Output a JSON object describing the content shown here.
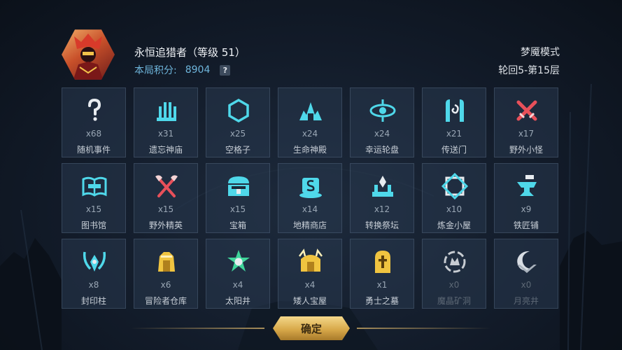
{
  "player": {
    "name": "永恒追猎者（等级 51）",
    "score_label": "本局积分:",
    "score_value": "8904",
    "help_icon": "?"
  },
  "mode": "梦魇模式",
  "floor": "轮回5-第15层",
  "cells": [
    {
      "icon": "question-icon",
      "count": "x68",
      "label": "随机事件",
      "dim": false
    },
    {
      "icon": "temple-icon",
      "count": "x31",
      "label": "遗忘神庙",
      "dim": false
    },
    {
      "icon": "hexagon-icon",
      "count": "x25",
      "label": "空格子",
      "dim": false
    },
    {
      "icon": "life-temple-icon",
      "count": "x24",
      "label": "生命神殿",
      "dim": false
    },
    {
      "icon": "wheel-icon",
      "count": "x24",
      "label": "幸运轮盘",
      "dim": false
    },
    {
      "icon": "portal-icon",
      "count": "x21",
      "label": "传送门",
      "dim": false
    },
    {
      "icon": "crossed-swords-icon",
      "count": "x17",
      "label": "野外小怪",
      "dim": false
    },
    {
      "icon": "book-icon",
      "count": "x15",
      "label": "图书馆",
      "dim": false
    },
    {
      "icon": "crossed-axes-icon",
      "count": "x15",
      "label": "野外精英",
      "dim": false
    },
    {
      "icon": "chest-icon",
      "count": "x15",
      "label": "宝箱",
      "dim": false
    },
    {
      "icon": "shop-icon",
      "count": "x14",
      "label": "地精商店",
      "dim": false
    },
    {
      "icon": "altar-icon",
      "count": "x12",
      "label": "转换祭坛",
      "dim": false
    },
    {
      "icon": "alchemy-icon",
      "count": "x10",
      "label": "炼金小屋",
      "dim": false
    },
    {
      "icon": "anvil-icon",
      "count": "x9",
      "label": "铁匠铺",
      "dim": false
    },
    {
      "icon": "seal-icon",
      "count": "x8",
      "label": "封印柱",
      "dim": false
    },
    {
      "icon": "warehouse-icon",
      "count": "x6",
      "label": "冒险者仓库",
      "dim": false
    },
    {
      "icon": "sun-well-icon",
      "count": "x4",
      "label": "太阳井",
      "dim": false
    },
    {
      "icon": "dwarf-treasure-icon",
      "count": "x4",
      "label": "矮人宝屋",
      "dim": false
    },
    {
      "icon": "tomb-icon",
      "count": "x1",
      "label": "勇士之墓",
      "dim": false
    },
    {
      "icon": "mine-icon",
      "count": "x0",
      "label": "魔晶矿洞",
      "dim": true
    },
    {
      "icon": "moon-well-icon",
      "count": "x0",
      "label": "月亮井",
      "dim": true
    }
  ],
  "confirm_label": "确定",
  "colors": {
    "cyan": "#4fd8ea",
    "gold": "#f0c440",
    "red": "#e8505a",
    "white": "#e8ecf0"
  }
}
